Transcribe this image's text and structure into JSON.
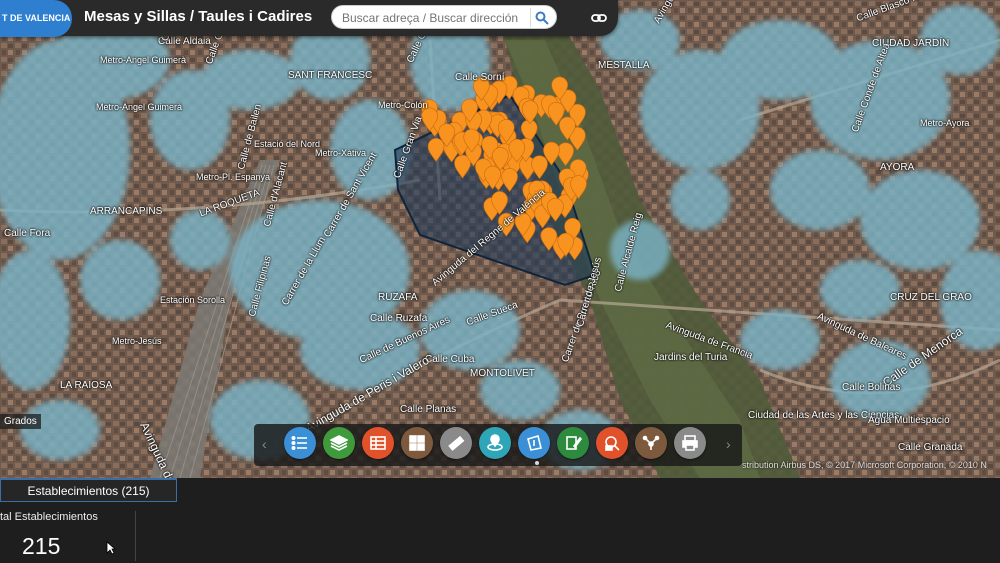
{
  "header": {
    "logo_text": "T DE VALENCIA",
    "title": "Mesas y Sillas / Taules i Cadires",
    "search_placeholder": "Buscar adreça / Buscar dirección"
  },
  "map": {
    "scale_label": "Grados",
    "attribution": "stribution Airbus DS, © 2017 Microsoft Corporation, © 2010 N",
    "street_labels": [
      "Calle Aldaia",
      "Metro-Angel Guimerà",
      "Metro-Angel Guimerà",
      "Calle Calderón",
      "SANT FRANCESC",
      "Calle Colón",
      "Calle Sorní",
      "MESTALLA",
      "Avinguda de Aragó",
      "Calle Blasco Ibañez",
      "CIUDAD JARDÍN",
      "Metro-Colón",
      "Metro-Xàtiva",
      "Estació del Nord",
      "Calle Guillem de Castro",
      "Metro-Pl. Espanya",
      "Calle de Bailen",
      "Calle d'Alacant",
      "Calle Gran Via",
      "LA ROQUETA",
      "ARRANCAPINS",
      "Carrer de Sant Vicent",
      "Carrer de la Llum",
      "Calle Ruzafa",
      "Avinguda del Regne de València",
      "Calle Sueca",
      "Calle Cuba",
      "Metro-Jesús",
      "RUZAFA",
      "Avinguda de Peris i Valero",
      "Calle Filipinas",
      "Calle de Buenos Aires",
      "Carrer de Puerto Rico",
      "MONTOLIVET",
      "Calle Planas",
      "Jardins del Turia",
      "Avinguda de Francia",
      "Avinguda de Baleares",
      "Calle de Menorca",
      "Ciudad de las Artes y las Ciencias",
      "Avinguda de Giorgeta",
      "LA RAIOSA",
      "Estación Sorolla",
      "Metro-Ayora",
      "AYORA",
      "CRUZ DEL GRAO",
      "Agua Multiespacio",
      "Calle Bolinas",
      "Calle Granada",
      "Calle Alcalde Reig",
      "Calle Conde de Altea",
      "Carrer de Jesús",
      "Calle Fora"
    ]
  },
  "toolbar": {
    "items": [
      {
        "name": "legend",
        "icon": "list-icon",
        "color": "#3b8fd6"
      },
      {
        "name": "layers",
        "icon": "layers-icon",
        "color": "#3f9a3c"
      },
      {
        "name": "table",
        "icon": "table-icon",
        "color": "#e1522b"
      },
      {
        "name": "basemap",
        "icon": "grid-icon",
        "color": "#7d5a3e"
      },
      {
        "name": "measure",
        "icon": "ruler-icon",
        "color": "#8a8a8a"
      },
      {
        "name": "locate",
        "icon": "location-icon",
        "color": "#2fa5b8"
      },
      {
        "name": "select",
        "icon": "select-polygon-icon",
        "color": "#3b8fd6"
      },
      {
        "name": "draw",
        "icon": "draw-icon",
        "color": "#2e8b3e"
      },
      {
        "name": "query",
        "icon": "query-icon",
        "color": "#e1522b"
      },
      {
        "name": "share",
        "icon": "network-icon",
        "color": "#7d5a3e"
      },
      {
        "name": "print",
        "icon": "print-icon",
        "color": "#8a8a8a"
      }
    ]
  },
  "bottom_panel": {
    "tab_label": "Establecimientos (215)",
    "card_label": "tal Establecimientos",
    "card_value": "215"
  },
  "colors": {
    "heat": "#7ab3c6",
    "marker": "#f7931e",
    "selection": "#1f3a5a"
  }
}
